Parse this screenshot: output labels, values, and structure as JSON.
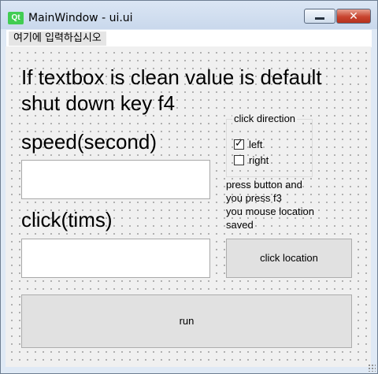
{
  "window": {
    "title": "MainWindow - ui.ui",
    "icon_label": "Qt",
    "close_glyph": "✕"
  },
  "menubar": {
    "item_label": "여기에 입력하십시오"
  },
  "form": {
    "heading_line1": "If textbox is clean value is default",
    "heading_line2": "shut down key f4",
    "speed_label": "speed(second)",
    "speed_value": "",
    "click_label": "click(tims)",
    "click_value": "",
    "direction_group": {
      "title": "click direction",
      "options": [
        {
          "label": "left",
          "checked": true
        },
        {
          "label": "right",
          "checked": false
        }
      ]
    },
    "note_lines": [
      "press button and",
      "you press f3",
      "you mouse location",
      "saved"
    ],
    "click_location_button": "click location",
    "run_button": "run"
  }
}
